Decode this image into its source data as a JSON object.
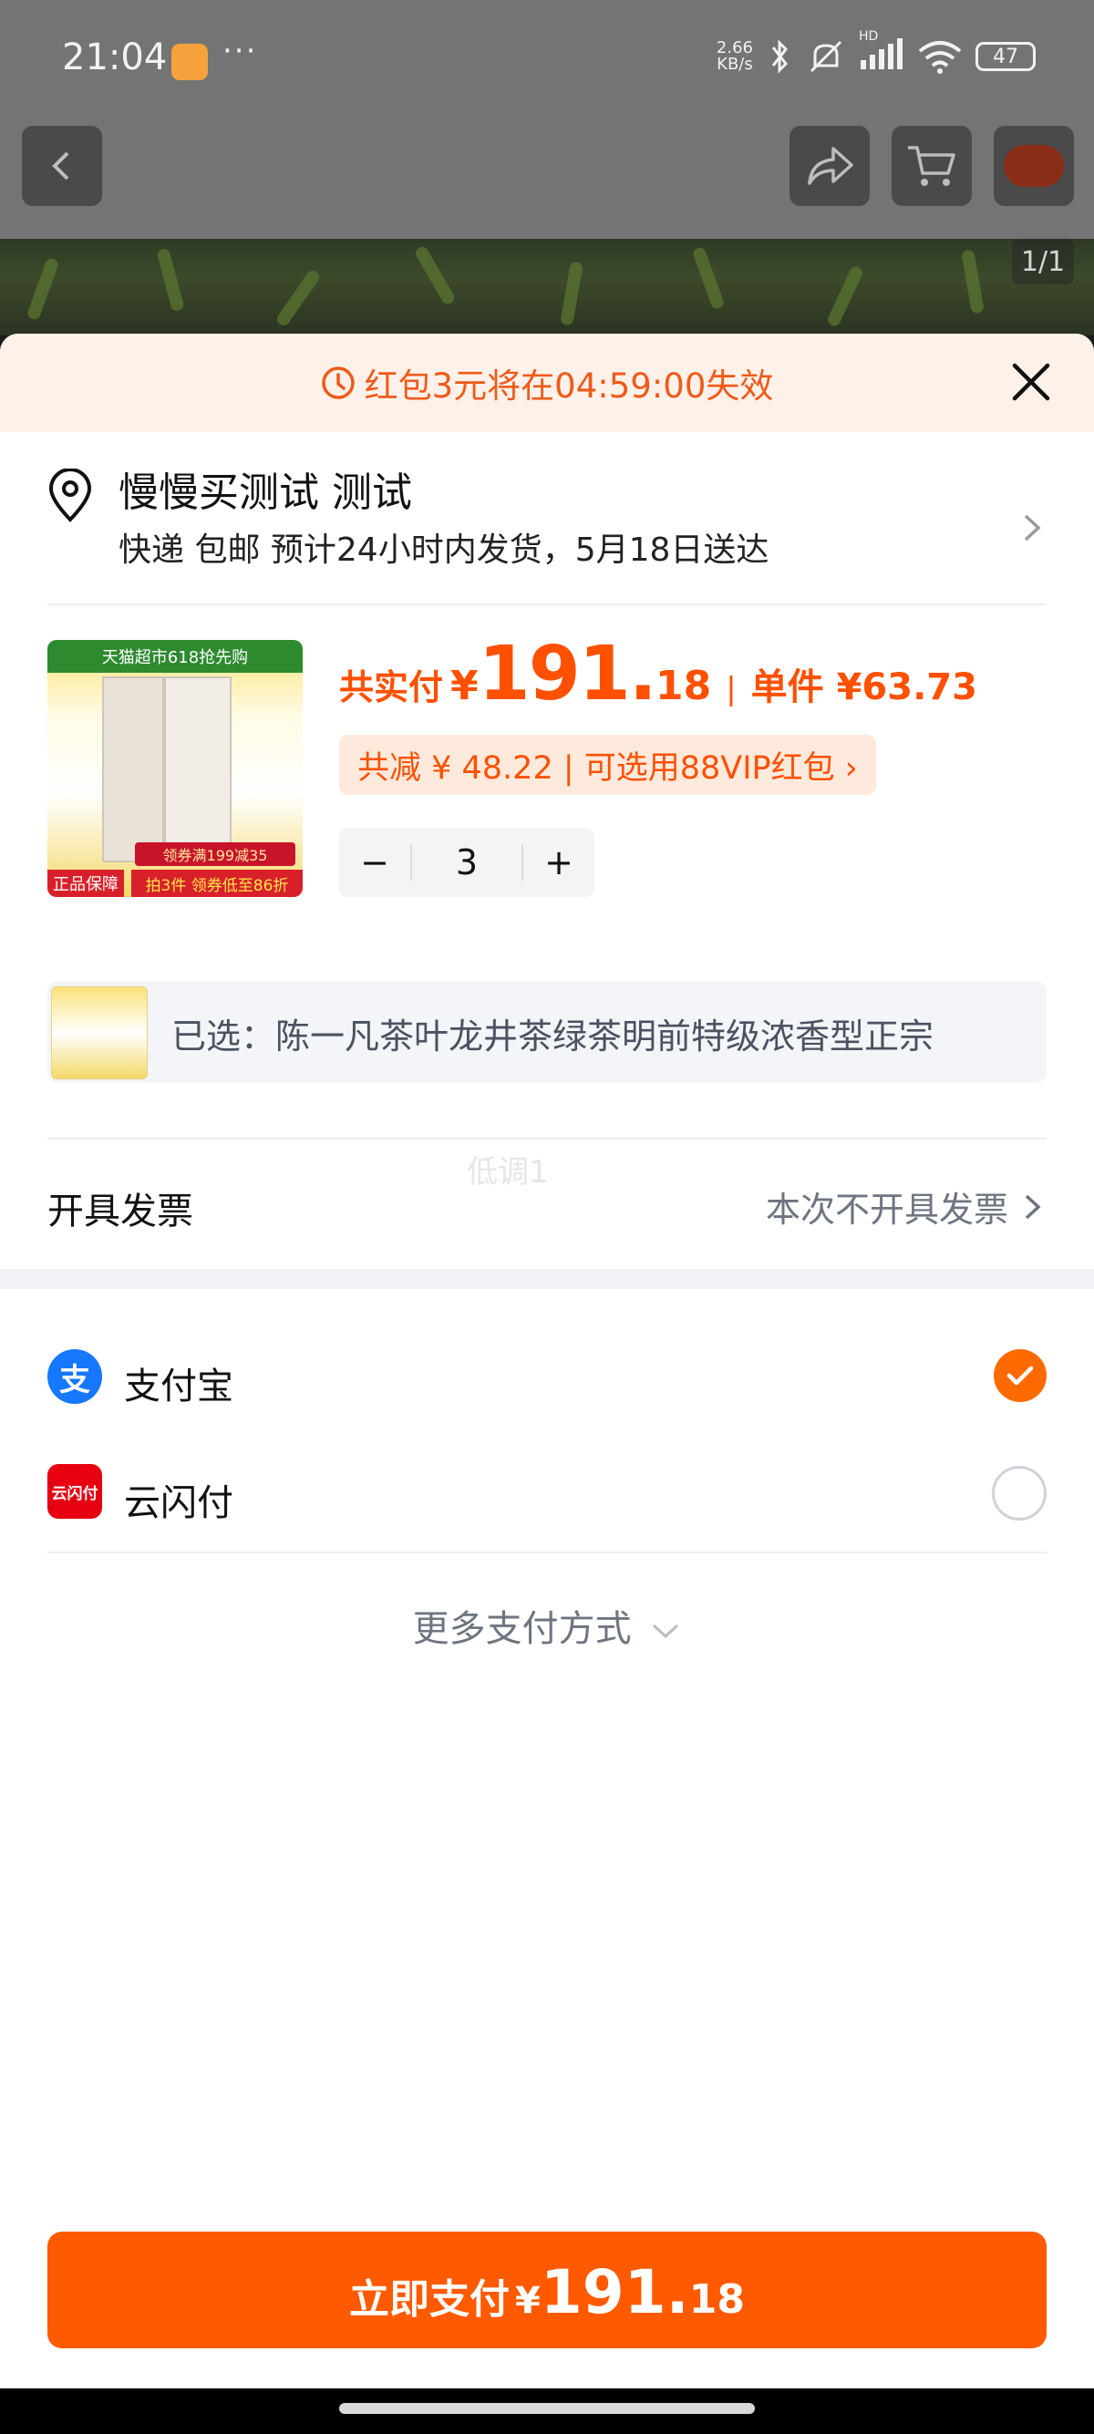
{
  "status_bar": {
    "time": "21:04",
    "dots": "···",
    "net_speed_value": "2.66",
    "net_speed_unit": "KB/s",
    "hd": "HD",
    "battery": "47"
  },
  "top": {
    "page_indicator": "1/1"
  },
  "banner": {
    "text": "红包3元将在04:59:00失效"
  },
  "address": {
    "name": "慢慢买测试 测试",
    "detail": "快递 包邮 预计24小时内发货，5月18日送达"
  },
  "product": {
    "thumb_top_text": "天猫超市618抢先购",
    "thumb_badge_left": "正品保障",
    "thumb_badge_mid": "领券满199减35",
    "thumb_badge_right": "拍3件 领券低至86折",
    "price_label": "共实付",
    "price_yen": "¥",
    "price_int": "191.",
    "price_dec": "18",
    "separator": "|",
    "unit_price": "单件 ¥63.73",
    "discount_text": "共减 ¥ 48.22 | 可选用88VIP红包 ›",
    "qty_minus": "−",
    "qty": "3",
    "qty_plus": "+"
  },
  "selected": {
    "text": "已选：陈一凡茶叶龙井茶绿茶明前特级浓香型正宗"
  },
  "watermark": "低调1",
  "invoice": {
    "label": "开具发票",
    "value": "本次不开具发票"
  },
  "payment": {
    "methods": [
      {
        "label": "支付宝",
        "selected": true,
        "color": "#1677ff"
      },
      {
        "label": "云闪付",
        "selected": false,
        "color": "#e60012"
      }
    ],
    "alipay_glyph": "支",
    "unionpay_glyph": "云闪付",
    "more_label": "更多支付方式"
  },
  "pay_button": {
    "text": "立即支付",
    "yen": "¥",
    "int": "191.",
    "dec": "18"
  },
  "colors": {
    "accent": "#ff5a00",
    "banner_bg": "#fdf1ea",
    "banner_text": "#f05a18"
  }
}
